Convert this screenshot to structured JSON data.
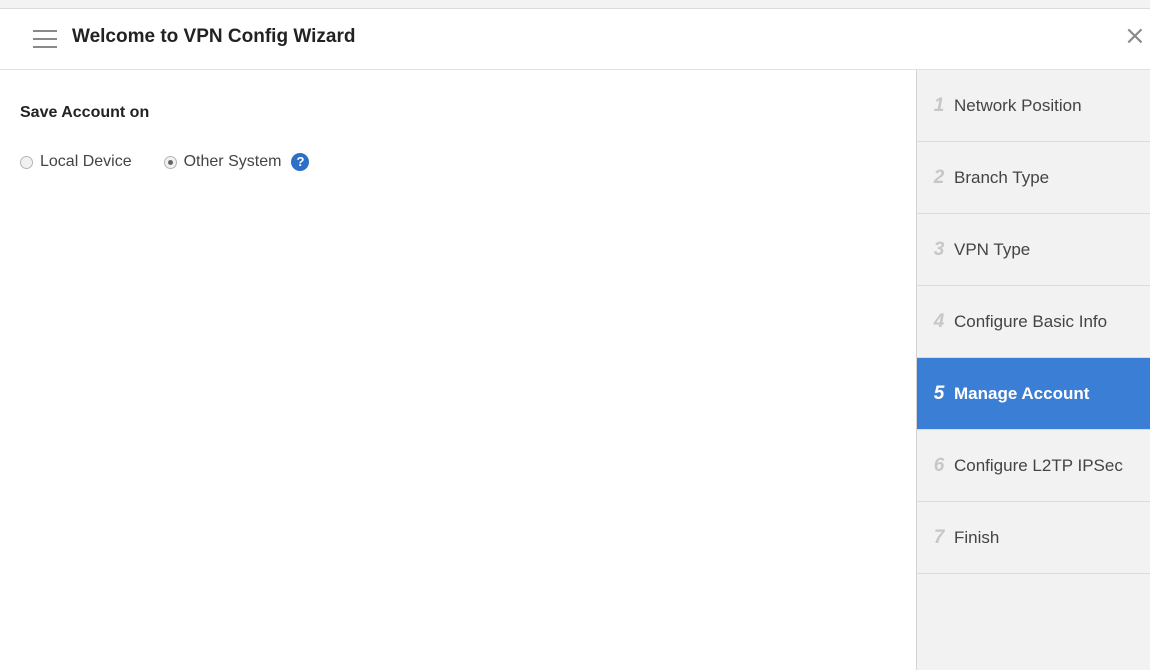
{
  "header": {
    "title": "Welcome to VPN Config Wizard",
    "close_label": "×"
  },
  "content": {
    "section_label": "Save Account on",
    "options": [
      {
        "label": "Local Device",
        "selected": false
      },
      {
        "label": "Other System",
        "selected": true
      }
    ],
    "help_glyph": "?"
  },
  "steps": [
    {
      "num": "1",
      "label": "Network Position",
      "active": false
    },
    {
      "num": "2",
      "label": "Branch Type",
      "active": false
    },
    {
      "num": "3",
      "label": "VPN Type",
      "active": false
    },
    {
      "num": "4",
      "label": "Configure Basic Info",
      "active": false
    },
    {
      "num": "5",
      "label": "Manage Account",
      "active": true
    },
    {
      "num": "6",
      "label": "Configure L2TP IPSec",
      "active": false
    },
    {
      "num": "7",
      "label": "Finish",
      "active": false
    }
  ],
  "colors": {
    "accent": "#3a7fd5",
    "help_icon": "#2b6fc7",
    "sidebar_bg": "#f2f2f2"
  },
  "icons": {
    "menu": "hamburger-menu-icon",
    "close": "close-icon",
    "help": "question-circle-icon"
  }
}
